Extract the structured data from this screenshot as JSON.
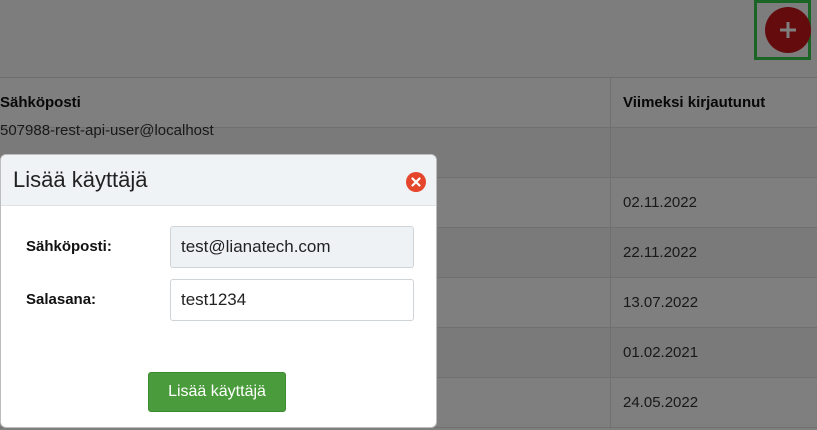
{
  "colors": {
    "fab": "#c8161d",
    "focus_outline": "#35c84a",
    "submit_button": "#4a9b3b",
    "close_icon": "#e4452b"
  },
  "header": {
    "add_button_icon": "plus-icon"
  },
  "table": {
    "columns": [
      "Sähköposti",
      "Viimeksi kirjautunut"
    ],
    "rows": [
      {
        "email": "507988-rest-api-user@localhost",
        "last_login": ""
      },
      {
        "email": "",
        "last_login": "02.11.2022"
      },
      {
        "email": "",
        "last_login": "22.11.2022"
      },
      {
        "email": "",
        "last_login": "13.07.2022"
      },
      {
        "email": "",
        "last_login": "01.02.2021"
      },
      {
        "email": "",
        "last_login": "24.05.2022"
      }
    ]
  },
  "modal": {
    "title": "Lisää käyttäjä",
    "close_icon": "close-icon",
    "email_label": "Sähköposti:",
    "email_value": "test@lianatech.com",
    "password_label": "Salasana:",
    "password_value": "test1234",
    "submit_label": "Lisää käyttäjä"
  }
}
